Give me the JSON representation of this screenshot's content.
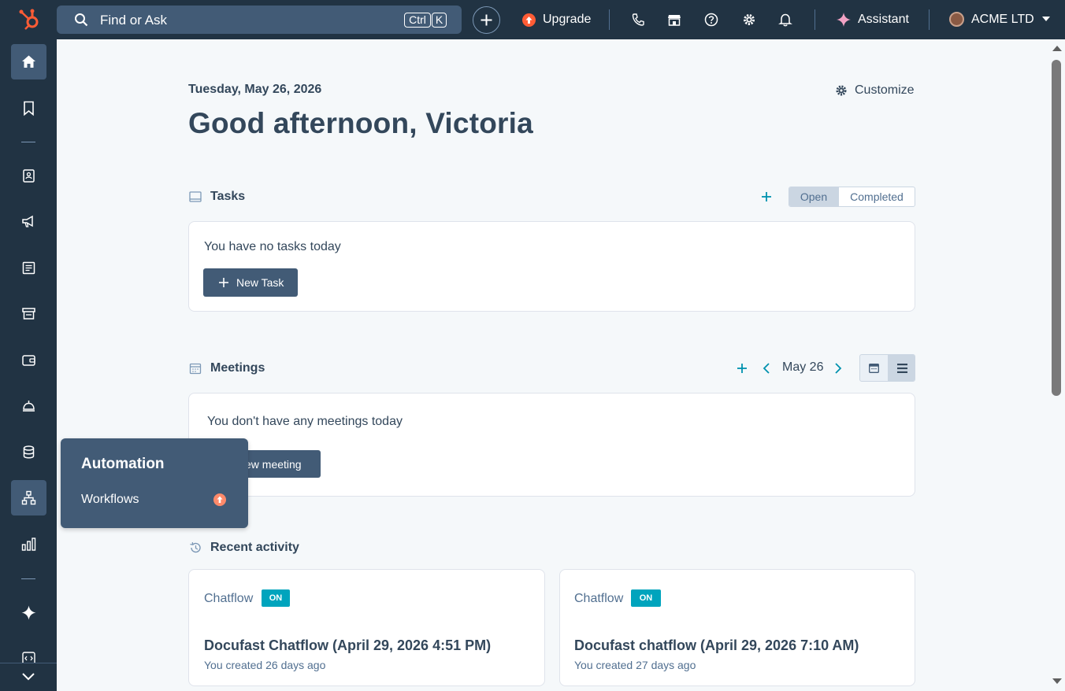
{
  "topbar": {
    "search_placeholder": "Find or Ask",
    "shortcut_ctrl": "Ctrl",
    "shortcut_k": "K",
    "upgrade_label": "Upgrade",
    "assistant_label": "Assistant",
    "account_name": "ACME LTD"
  },
  "header": {
    "date": "Tuesday, May 26, 2026",
    "greeting": "Good afternoon, Victoria",
    "customize_label": "Customize"
  },
  "tasks": {
    "title": "Tasks",
    "filter_open": "Open",
    "filter_completed": "Completed",
    "selected_filter": "Open",
    "empty_text": "You have no tasks today",
    "new_task_label": "New Task"
  },
  "meetings": {
    "title": "Meetings",
    "date": "May 26",
    "empty_text": "You don't have any meetings today",
    "new_meeting_label": "ew meeting"
  },
  "popover": {
    "title": "Automation",
    "item": "Workflows"
  },
  "recent_activity": {
    "title": "Recent activity",
    "items": [
      {
        "type": "Chatflow",
        "badge": "ON",
        "title": "Docufast Chatflow (April 29, 2026 4:51 PM)",
        "subtitle": "You created 26 days ago"
      },
      {
        "type": "Chatflow",
        "badge": "ON",
        "title": "Docufast chatflow (April 29, 2026 7:10 AM)",
        "subtitle": "You created 27 days ago"
      }
    ]
  },
  "colors": {
    "nav_bg": "#213343",
    "accent_orange": "#ff5c35",
    "teal": "#00a4bd",
    "button_dark": "#425b76"
  }
}
